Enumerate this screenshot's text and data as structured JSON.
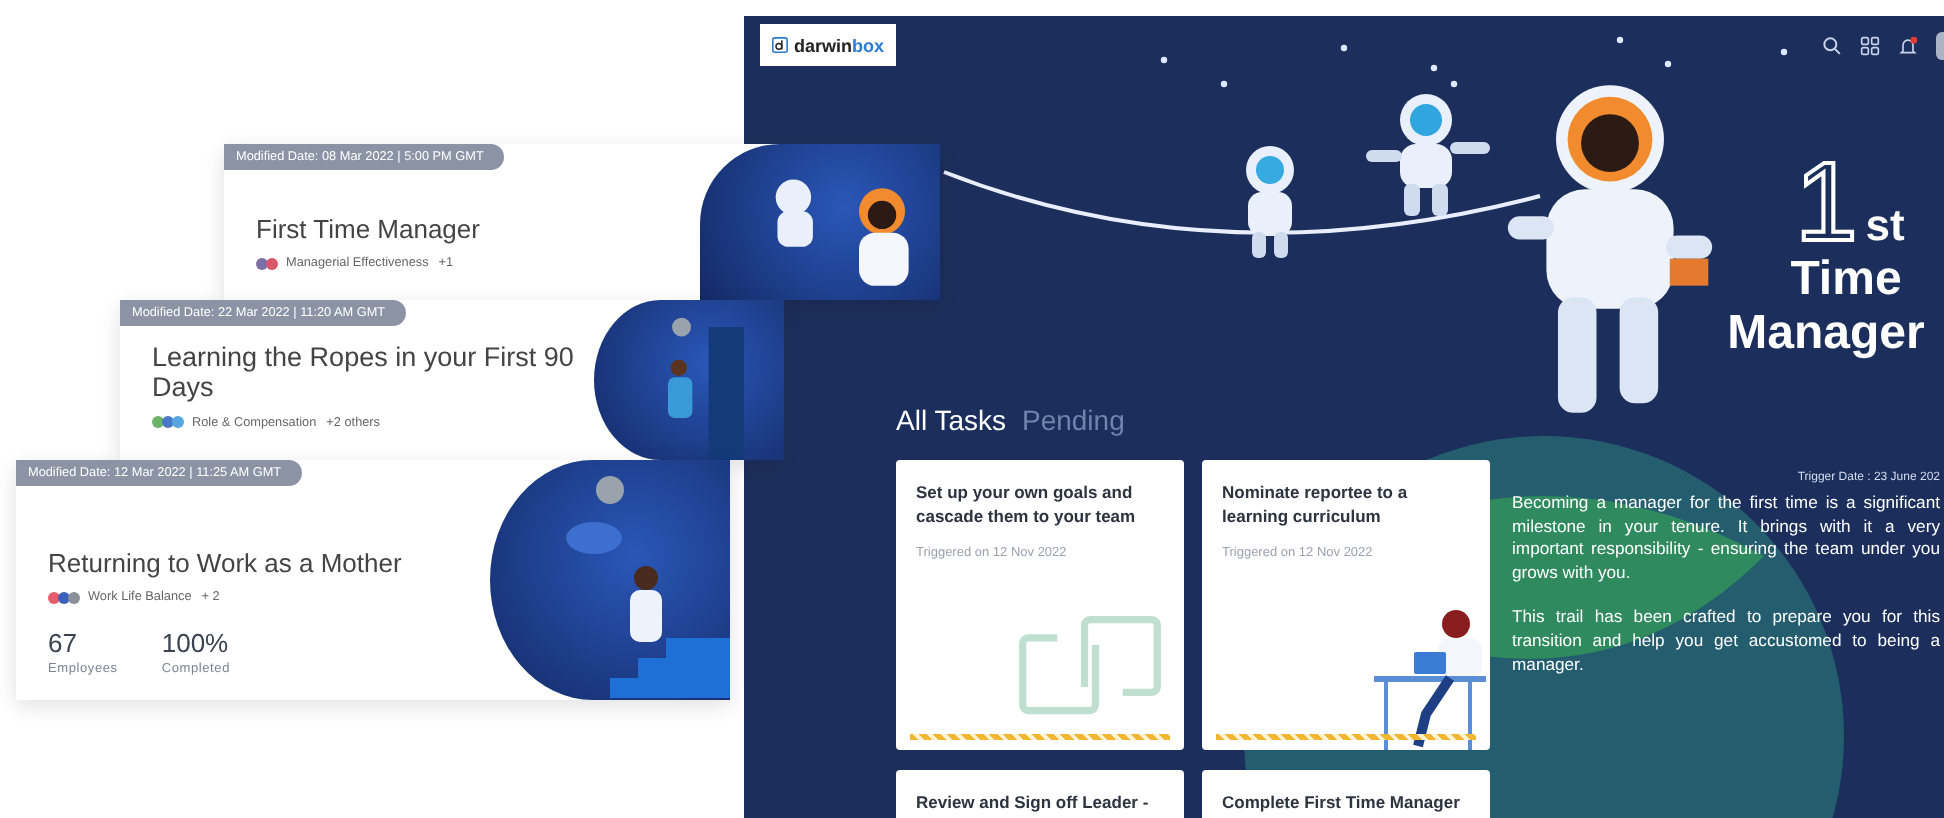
{
  "app": {
    "logo": {
      "name": "darwin",
      "accent": "box"
    },
    "hero_title": {
      "numeral": "1",
      "suffix": "st",
      "line2": "Time",
      "line3": "Manager"
    },
    "tabs": [
      {
        "label": "All Tasks",
        "selected": true
      },
      {
        "label": "Pending",
        "selected": false
      }
    ],
    "tasks": [
      {
        "title": "Set up your own goals and cascade them to your team",
        "triggered": "Triggered on 12 Nov 2022",
        "kind": "chain"
      },
      {
        "title": "Nominate reportee to a learning curriculum",
        "triggered": "Triggered on 12 Nov 2022",
        "kind": "desk"
      },
      {
        "title": "Review and Sign off Leader -",
        "kind": "plain"
      },
      {
        "title": "Complete First Time Manager",
        "kind": "plain"
      }
    ],
    "description": {
      "trigger_date": "Trigger Date : 23 June 202",
      "paragraphs": [
        "Becoming a manager for the first time is a significant milestone in your tenure. It brings with it a very important responsibility - ensuring the team under you grows with you.",
        "This trail has been crafted to prepare you for this transition and help you get accustomed to being a manager."
      ]
    }
  },
  "journey_cards": [
    {
      "modified": "Modified Date: 08 Mar 2022 | 5:00 PM GMT",
      "title": "First Time Manager",
      "tag": {
        "dots": [
          {
            "color": "#7b6fa6"
          },
          {
            "color": "#d9566b"
          }
        ],
        "label": "Managerial Effectiveness",
        "extra": "+1"
      },
      "kind": "astronauts"
    },
    {
      "modified": "Modified Date: 22 Mar 2022 | 11:20 AM GMT",
      "title": "Learning the Ropes in your First 90 Days",
      "tag": {
        "dots": [
          {
            "color": "#6bb36b"
          },
          {
            "color": "#4a78c9"
          },
          {
            "color": "#56a7e0"
          }
        ],
        "label": "Role & Compensation",
        "extra": "+2 others"
      },
      "kind": "door"
    },
    {
      "modified": "Modified Date: 12 Mar 2022 | 11:25 AM GMT",
      "title": "Returning to Work as a Mother",
      "tag": {
        "dots": [
          {
            "color": "#e35d6a"
          },
          {
            "color": "#3c5fb8"
          },
          {
            "color": "#8a8f99"
          }
        ],
        "label": "Work Life Balance",
        "extra": "+ 2"
      },
      "kind": "stairs",
      "stats": [
        {
          "value": "67",
          "label": "Employees"
        },
        {
          "value": "100%",
          "label": "Completed"
        }
      ]
    }
  ]
}
